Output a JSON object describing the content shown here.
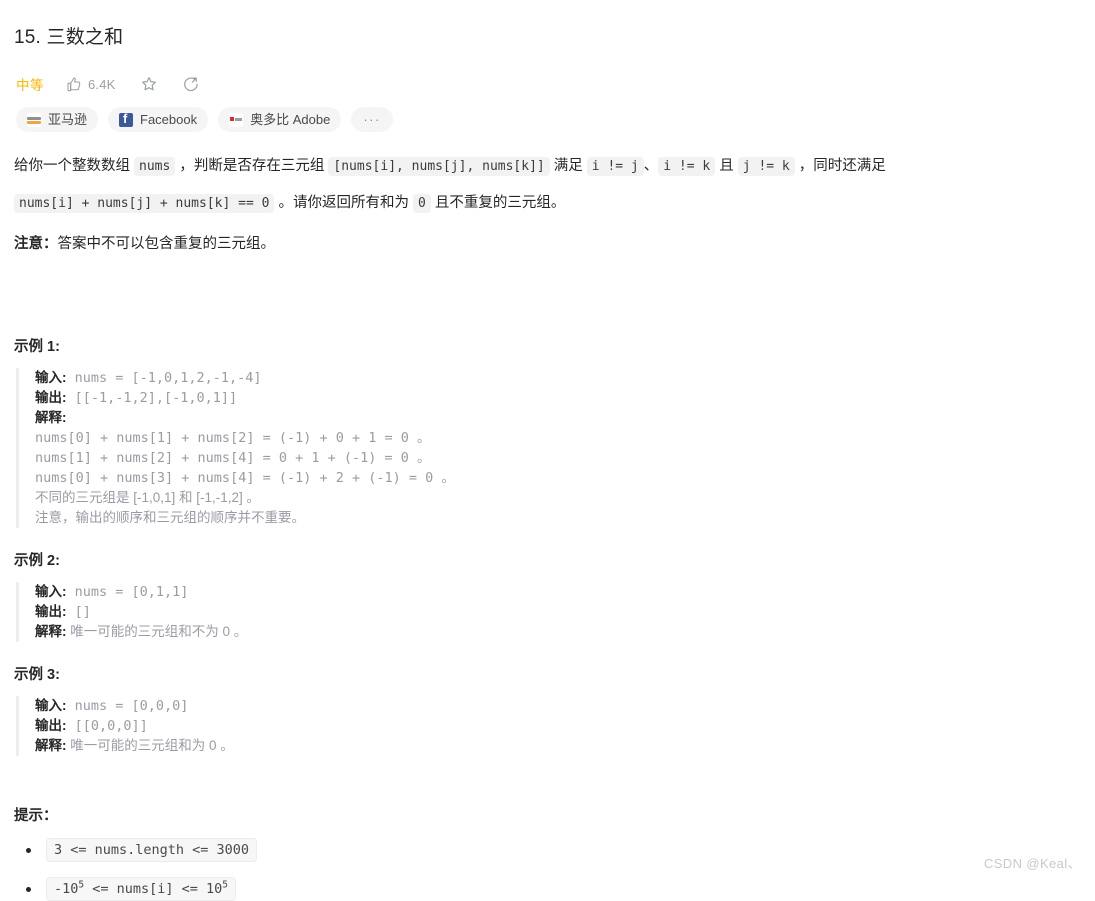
{
  "header": {
    "title": "15. 三数之和",
    "difficulty": "中等",
    "likes": "6.4K",
    "icons": {
      "thumbs_up": "thumbs-up-icon",
      "star": "star-icon",
      "share": "share-icon"
    }
  },
  "company_tags": [
    {
      "name": "亚马逊",
      "logo": "amazon-logo"
    },
    {
      "name": "Facebook",
      "logo": "facebook-logo"
    },
    {
      "name": "奥多比 Adobe",
      "logo": "adobe-logo"
    },
    {
      "name": "···",
      "logo": "more-icon"
    }
  ],
  "description": {
    "p1_a": "给你一个整数数组 ",
    "code_nums": "nums",
    "p1_b": " ，判断是否存在三元组 ",
    "code_triplet": "[nums[i], nums[j], nums[k]]",
    "p1_c": " 满足 ",
    "code_i_ne_j": "i != j",
    "p1_d": "、",
    "code_i_ne_k": "i != k",
    "p1_e": " 且 ",
    "code_j_ne_k": "j != k",
    "p1_f": " ，同时还满足 ",
    "code_sum": "nums[i] + nums[j] + nums[k] == 0",
    "p1_g": " 。请你返回所有和为 ",
    "code_zero": "0",
    "p1_h": " 且不重复的三元组。",
    "note_label": "注意：",
    "note_text": "答案中不可以包含重复的三元组。"
  },
  "examples": [
    {
      "heading": "示例 1:",
      "lines": [
        {
          "label": "输入:",
          "value": " nums = [-1,0,1,2,-1,-4]"
        },
        {
          "label": "输出:",
          "value": " [[-1,-1,2],[-1,0,1]]"
        },
        {
          "label": "解释:",
          "value": ""
        },
        {
          "label": "",
          "value": "nums[0] + nums[1] + nums[2] = (-1) + 0 + 1 = 0 。"
        },
        {
          "label": "",
          "value": "nums[1] + nums[2] + nums[4] = 0 + 1 + (-1) = 0 。"
        },
        {
          "label": "",
          "value": "nums[0] + nums[3] + nums[4] = (-1) + 2 + (-1) = 0 。"
        },
        {
          "label": "",
          "value": "不同的三元组是 [-1,0,1] 和 [-1,-1,2] 。"
        },
        {
          "label": "",
          "value": "注意，输出的顺序和三元组的顺序并不重要。"
        }
      ]
    },
    {
      "heading": "示例 2:",
      "lines": [
        {
          "label": "输入:",
          "value": " nums = [0,1,1]"
        },
        {
          "label": "输出:",
          "value": " []"
        },
        {
          "label": "解释:",
          "value": " 唯一可能的三元组和不为 0 。"
        }
      ]
    },
    {
      "heading": "示例 3:",
      "lines": [
        {
          "label": "输入:",
          "value": " nums = [0,0,0]"
        },
        {
          "label": "输出:",
          "value": " [[0,0,0]]"
        },
        {
          "label": "解释:",
          "value": " 唯一可能的三元组和为 0 。"
        }
      ]
    }
  ],
  "hints": {
    "heading": "提示：",
    "items": [
      {
        "text": "3 <= nums.length <= 3000",
        "sup": false
      },
      {
        "text": "-10",
        "sup_1": "5",
        "mid": " <= nums[i] <= 10",
        "sup_2": "5",
        "sup": true
      }
    ]
  },
  "watermark": "CSDN @Keal、",
  "colors": {
    "difficulty_medium": "#ffb800",
    "text_primary": "#262626",
    "code_muted": "#9b9ba6",
    "pill_bg": "#f5f5f5",
    "facebook_blue": "#3b5998",
    "adobe_red": "#e1262c",
    "amazon_orange": "#f0a63a"
  }
}
